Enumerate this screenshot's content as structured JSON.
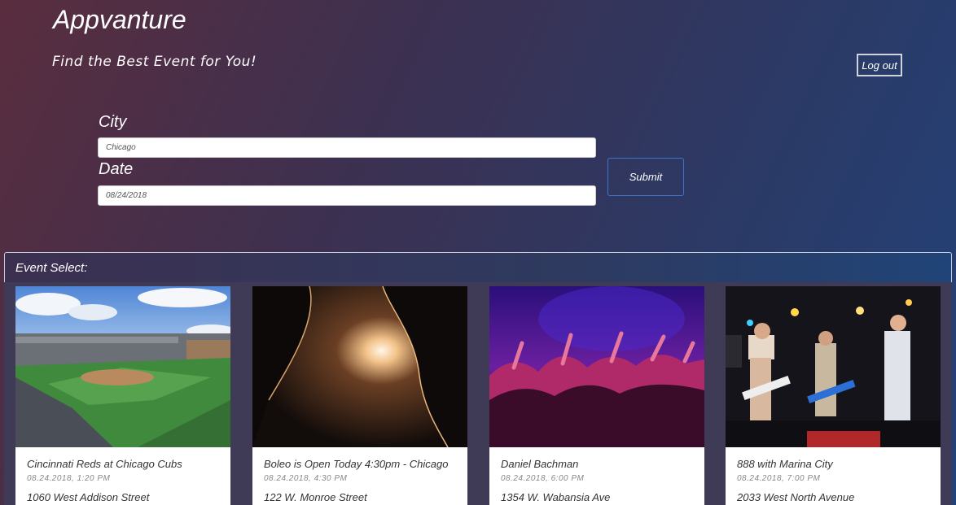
{
  "header": {
    "title": "Appvanture",
    "tagline": "Find the Best Event for You!",
    "logout_label": "Log out"
  },
  "form": {
    "city_label": "City",
    "city_value": "Chicago",
    "date_label": "Date",
    "date_value": "08/24/2018",
    "submit_label": "Submit"
  },
  "events": {
    "header": "Event Select:",
    "items": [
      {
        "title": "Cincinnati Reds at Chicago Cubs",
        "datetime": "08.24.2018, 1:20 PM",
        "address": "1060 West Addison Street",
        "image": "baseball-stadium"
      },
      {
        "title": "Boleo is Open Today 4:30pm - Chicago",
        "datetime": "08.24.2018, 4:30 PM",
        "address": "122 W. Monroe Street",
        "image": "backlit-silhouette"
      },
      {
        "title": "Daniel Bachman",
        "datetime": "08.24.2018, 6:00 PM",
        "address": "1354 W. Wabansia Ave",
        "image": "concert-crowd"
      },
      {
        "title": "888 with Marina City",
        "datetime": "08.24.2018, 7:00 PM",
        "address": "2033 West North Avenue",
        "image": "band-on-stage"
      }
    ]
  }
}
